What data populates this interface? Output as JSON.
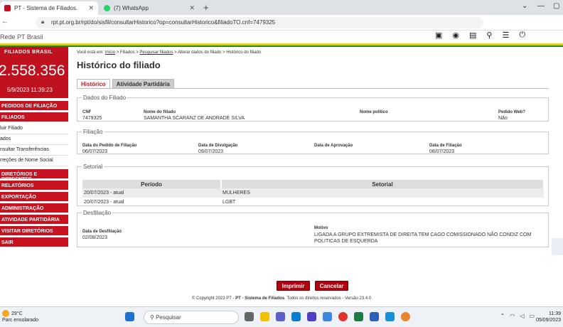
{
  "browser": {
    "tabs": [
      {
        "label": "PT - Sistema de Filiados."
      },
      {
        "label": "(7) WhatsApp"
      }
    ],
    "url": "rpt.pt.org.br/rpt/do/sisfil/consultarHistorico?op=consultarHistorico&filiadoTO.cnf=7479325",
    "profile_initial": "L"
  },
  "site": {
    "brand": "Rede PT Brasil"
  },
  "sidebar": {
    "counter_label": "FILIADOS BRASIL",
    "counter_value": "2.558.356",
    "counter_datetime": "5/9/2023 11:39:23",
    "menu": [
      {
        "label": "Pedidos de Filiação"
      },
      {
        "label": "Filiados"
      }
    ],
    "submenu": [
      {
        "label": "luir Filiado"
      },
      {
        "label": "ados"
      },
      {
        "label": "nsultar Transferências"
      },
      {
        "label": "rreções de Nome Social"
      }
    ],
    "menu2": [
      {
        "label": "Diretórios e Dirigentes"
      },
      {
        "label": "Relatórios"
      },
      {
        "label": "Exportação"
      },
      {
        "label": "Administração"
      },
      {
        "label": "Atividade Partidária"
      },
      {
        "label": "Visitar Diretórios"
      },
      {
        "label": "Sair"
      }
    ]
  },
  "breadcrumb": {
    "prefix": "Você está em:",
    "items": [
      "Início",
      "Filiados",
      "Pesquisar filiados",
      "Alterar dados do filiado",
      "Histórico do filiado"
    ]
  },
  "page_title": "Histórico do filiado",
  "page_tabs": [
    {
      "label": "Histórico"
    },
    {
      "label": "Atividade Partidária"
    }
  ],
  "dados": {
    "legend": "Dados do Filiado",
    "cnf_label": "CNF",
    "cnf": "7479325",
    "nome_label": "Nome do filiado",
    "nome": "SAMANTHA SCARANZ DE ANDRADE SILVA",
    "nome_politico_label": "Nome político",
    "nome_politico": "",
    "pedido_web_label": "Pedido Web?",
    "pedido_web": "Não"
  },
  "filiacao": {
    "legend": "Filiação",
    "pedido_label": "Data do Pedido de Filiação",
    "pedido": "06/07/2023",
    "divulgacao_label": "Data de Divulgação",
    "divulgacao": "09/07/2023",
    "aprovacao_label": "Data de Aprovação",
    "aprovacao": "",
    "filiacao_label": "Data de Filiação",
    "filiacao": "08/07/2023"
  },
  "setorial": {
    "legend": "Setorial",
    "headers": [
      "Período",
      "Setorial"
    ],
    "rows": [
      {
        "periodo": "20/07/2023 - atual",
        "setorial": "MULHERES"
      },
      {
        "periodo": "20/07/2023 - atual",
        "setorial": "LGBT"
      }
    ]
  },
  "desfiliacao": {
    "legend": "Desfiliação",
    "data_label": "Data de Desfiliação",
    "data": "02/08/2023",
    "motivo_label": "Motivo",
    "motivo": "LIGADA A GRUPO EXTREMISTA DE DIREITA TEM CAGO COMISSIONADO NÃO CONDIZ COM POLITICAS DE ESQUERDA"
  },
  "buttons": {
    "print": "Imprimir",
    "cancel": "Cancelar"
  },
  "footer": {
    "prefix": "© Copyright 2023 PT - ",
    "system": "PT - Sistema de Filiados",
    "suffix": ". Todos os direitos reservados - Versão 23.4.0"
  },
  "taskbar": {
    "temp": "29°C",
    "weather": "Parc ensolarado",
    "search_placeholder": "Pesquisar",
    "time": "11:39",
    "date": "05/09/2023"
  },
  "colors": {
    "brand_red": "#c0111f",
    "stripe_yellow": "#f0d000",
    "stripe_green": "#1a8a2a"
  }
}
